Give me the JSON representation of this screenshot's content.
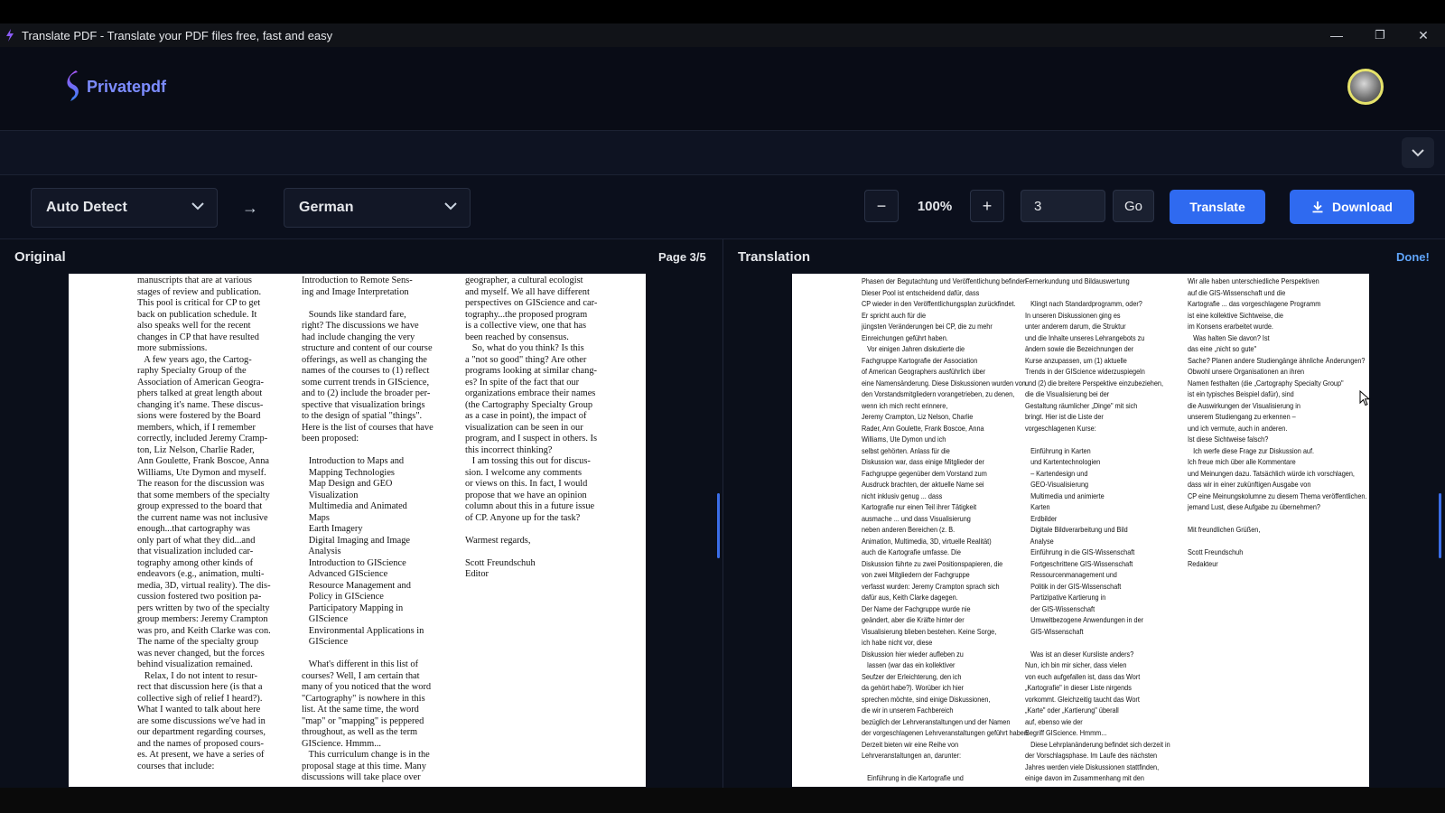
{
  "window": {
    "title": "Translate PDF - Translate your PDF files free, fast and easy",
    "minimize": "—",
    "restore": "❐",
    "close": "✕"
  },
  "brand": {
    "name": "Privatepdf",
    "accent": "#7c8cff"
  },
  "toolbar": {
    "source_lang": "Auto Detect",
    "target_lang": "German",
    "arrow": "→",
    "zoom_out": "−",
    "zoom": "100%",
    "zoom_in": "+",
    "page_value": "3",
    "go": "Go",
    "translate": "Translate",
    "download": "Download"
  },
  "original": {
    "label": "Original",
    "page_indicator": "Page 3/5",
    "columns": [
      "manuscripts that are at various\nstages of review and publication.\nThis pool is critical for CP to get\nback on publication schedule. It\nalso speaks well for the recent\nchanges in CP that have resulted\nmore submissions.\n   A few years ago, the Cartog-\nraphy Specialty Group of the\nAssociation of American Geogra-\nphers talked at great length about\nchanging it's name. These discus-\nsions were fostered by the Board\nmembers, which, if I remember\ncorrectly, included Jeremy Cramp-\nton, Liz Nelson, Charlie Rader,\nAnn Goulette, Frank Boscoe, Anna\nWilliams, Ute Dymon and myself.\nThe reason for the discussion was\nthat some members of the specialty\ngroup expressed to the board that\nthe current name was not inclusive\nenough...that cartography was\nonly part of what they did...and\nthat visualization included car-\ntography among other kinds of\nendeavors (e.g., animation, multi-\nmedia, 3D, virtual reality). The dis-\ncussion fostered two position pa-\npers written by two of the specialty\ngroup members: Jeremy Crampton\nwas pro, and Keith Clarke was con.\nThe name of the specialty group\nwas never changed, but the forces\nbehind visualization remained.\n   Relax, I do not intent to resur-\nrect that discussion here (is that a\ncollective sigh of relief I heard?).\nWhat I wanted to talk about here\nare some discussions we've had in\nour department regarding courses,\nand the names of proposed cours-\nes. At present, we have a series of\ncourses that include:",
      "Introduction to Remote Sens-\ning and Image Interpretation\n\n   Sounds like standard fare,\nright? The discussions we have\nhad include changing the very\nstructure and content of our course\nofferings, as well as changing the\nnames of the courses to (1) reflect\nsome current trends in GIScience,\nand to (2) include the broader per-\nspective that visualization brings\nto the design of spatial \"things\".\nHere is the list of courses that have\nbeen proposed:\n\n   Introduction to Maps and\n   Mapping Technologies\n   Map Design and GEO\n   Visualization\n   Multimedia and Animated\n   Maps\n   Earth Imagery\n   Digital Imaging and Image\n   Analysis\n   Introduction to GIScience\n   Advanced GIScience\n   Resource Management and\n   Policy in GIScience\n   Participatory Mapping in\n   GIScience\n   Environmental Applications in\n   GIScience\n\n   What's different in this list of\ncourses? Well, I am certain that\nmany of you noticed that the word\n\"Cartography\" is nowhere in this\nlist. At the same time, the word\n\"map\" or \"mapping\" is peppered\nthroughout, as well as the term\nGIScience. Hmmm...\n   This curriculum change is in the\nproposal stage at this time. Many\ndiscussions will take place over",
      "geographer, a cultural ecologist\nand myself. We all have different\nperspectives on GIScience and car-\ntography...the proposed program\nis a collective view, one that has\nbeen reached by consensus.\n   So, what do you think? Is this\na \"not so good\" thing? Are other\nprograms looking at similar chang-\nes? In spite of the fact that our\norganizations embrace their names\n(the Cartography Specialty Group\nas a case in point), the impact of\nvisualization can be seen in our\nprogram, and I suspect in others. Is\nthis incorrect thinking?\n   I am tossing this out for discus-\nsion. I welcome any comments\nor views on this. In fact, I would\npropose that we have an opinion\ncolumn about this in a future issue\nof CP. Anyone up for the task?\n\nWarmest regards,\n\nScott Freundschuh\nEditor"
    ]
  },
  "translation": {
    "label": "Translation",
    "status": "Done!",
    "columns": [
      "Phasen der Begutachtung und Veröffentlichung befinden.\nDieser Pool ist entscheidend dafür, dass\nCP wieder in den Veröffentlichungsplan zurückfindet.\nEr spricht auch für die\njüngsten Veränderungen bei CP, die zu mehr\nEinreichungen geführt haben.\n   Vor einigen Jahren diskutierte die\nFachgruppe Kartografie der Association\nof American Geographers ausführlich über\neine Namensänderung. Diese Diskussionen wurden von\nden Vorstandsmitgliedern vorangetrieben, zu denen,\nwenn ich mich recht erinnere,\nJeremy Crampton, Liz Nelson, Charlie\nRader, Ann Goulette, Frank Boscoe, Anna\nWilliams, Ute Dymon und ich\nselbst gehörten. Anlass für die\nDiskussion war, dass einige Mitglieder der\nFachgruppe gegenüber dem Vorstand zum\nAusdruck brachten, der aktuelle Name sei\nnicht inklusiv genug ... dass\nKartografie nur einen Teil ihrer Tätigkeit\nausmache ... und dass Visualisierung\nneben anderen Bereichen (z. B.\nAnimation, Multimedia, 3D, virtuelle Realität)\nauch die Kartografie umfasse. Die\nDiskussion führte zu zwei Positionspapieren, die\nvon zwei Mitgliedern der Fachgruppe\nverfasst wurden: Jeremy Crampton sprach sich\ndafür aus, Keith Clarke dagegen.\nDer Name der Fachgruppe wurde nie\ngeändert, aber die Kräfte hinter der\nVisualisierung blieben bestehen. Keine Sorge,\nich habe nicht vor, diese\nDiskussion hier wieder aufleben zu\n   lassen (war das ein kollektiver\nSeufzer der Erleichterung, den ich\nda gehört habe?). Worüber ich hier\nsprechen möchte, sind einige Diskussionen,\ndie wir in unserem Fachbereich\nbezüglich der Lehrveranstaltungen und der Namen\nder vorgeschlagenen Lehrveranstaltungen geführt haben.\nDerzeit bieten wir eine Reihe von\nLehrveranstaltungen an, darunter:\n\n   Einführung in die Kartografie und",
      "Fernerkundung und Bildauswertung\n\n   Klingt nach Standardprogramm, oder?\nIn unseren Diskussionen ging es\nunter anderem darum, die Struktur\nund die Inhalte unseres Lehrangebots zu\nändern sowie die Bezeichnungen der\nKurse anzupassen, um (1) aktuelle\nTrends in der GIScience widerzuspiegeln\nund (2) die breitere Perspektive einzubeziehen,\ndie die Visualisierung bei der\nGestaltung räumlicher „Dinge\" mit sich\nbringt. Hier ist die Liste der\nvorgeschlagenen Kurse:\n\n   Einführung in Karten\n   und Kartentechnologien\n   – Kartendesign und\n   GEO-Visualisierung\n   Multimedia und animierte\n   Karten\n   Erdbilder\n   Digitale Bildverarbeitung und Bild\n   Analyse\n   Einführung in die GIS-Wissenschaft\n   Fortgeschrittene GIS-Wissenschaft\n   Ressourcenmanagement und\n   Politik in der GIS-Wissenschaft\n   Partizipative Kartierung in\n   der GIS-Wissenschaft\n   Umweltbezogene Anwendungen in der\n   GIS-Wissenschaft\n\n   Was ist an dieser Kursliste anders?\nNun, ich bin mir sicher, dass vielen\nvon euch aufgefallen ist, dass das Wort\n„Kartografie\" in dieser Liste nirgends\nvorkommt. Gleichzeitig taucht das Wort\n„Karte\" oder „Kartierung\" überall\nauf, ebenso wie der\nBegriff GIScience. Hmmm...\n   Diese Lehrplanänderung befindet sich derzeit in\nder Vorschlagsphase. Im Laufe des nächsten\nJahres werden viele Diskussionen stattfinden,\neinige davon im Zusammenhang mit den",
      "Wir alle haben unterschiedliche Perspektiven\nauf die GIS-Wissenschaft und die\nKartografie ... das vorgeschlagene Programm\nist eine kollektive Sichtweise, die\nim Konsens erarbeitet wurde.\n   Was halten Sie davon? Ist\ndas eine „nicht so gute\"\nSache? Planen andere Studiengänge ähnliche Änderungen?\nObwohl unsere Organisationen an ihren\nNamen festhalten (die „Cartography Specialty Group\"\nist ein typisches Beispiel dafür), sind\ndie Auswirkungen der Visualisierung in\nunserem Studiengang zu erkennen –\nund ich vermute, auch in anderen.\nIst diese Sichtweise falsch?\n   Ich werfe diese Frage zur Diskussion auf.\nIch freue mich über alle Kommentare\nund Meinungen dazu. Tatsächlich würde ich vorschlagen,\ndass wir in einer zukünftigen Ausgabe von\nCP eine Meinungskolumne zu diesem Thema veröffentlichen. Hat\njemand Lust, diese Aufgabe zu übernehmen?\n\nMit freundlichen Grüßen,\n\nScott Freundschuh\nRedakteur"
    ]
  }
}
